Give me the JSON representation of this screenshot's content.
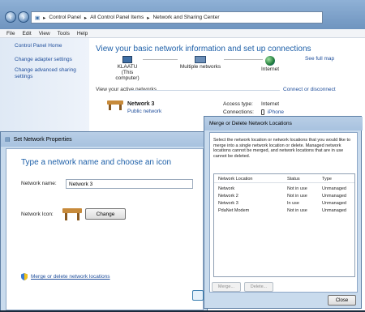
{
  "address_bar": {
    "crumbs": [
      "Control Panel",
      "All Control Panel Items",
      "Network and Sharing Center"
    ],
    "separator": "▸"
  },
  "menu": [
    "File",
    "Edit",
    "View",
    "Tools",
    "Help"
  ],
  "left_pane": {
    "links": [
      "Control Panel Home",
      "Change adapter settings",
      "Change advanced sharing settings"
    ]
  },
  "main": {
    "heading": "View your basic network information and set up connections",
    "see_full_map": "See full map",
    "map": {
      "computer": "KLAATU",
      "computer_sub": "(This computer)",
      "middle": "Multiple networks",
      "internet": "Internet"
    },
    "active_networks_label": "View your active networks",
    "connect_disconnect": "Connect or disconnect",
    "network": {
      "name": "Network 3",
      "type": "Public network",
      "access_label": "Access type:",
      "access_value": "Internet",
      "connections_label": "Connections:",
      "connections_value": "iPhone"
    }
  },
  "set_props_dialog": {
    "title": "Set Network Properties",
    "heading": "Type a network name and choose an icon",
    "name_label": "Network name:",
    "name_value": "Network 3",
    "icon_label": "Network Icon:",
    "change_button": "Change",
    "merge_link": "Merge or delete network locations"
  },
  "merge_dialog": {
    "title": "Merge or Delete Network Locations",
    "description": "Select the network location or network locations that you would like to merge into a single network location or delete. Managed network locations cannot be merged, and network locations that are in use cannot be deleted.",
    "columns": [
      "Network Location",
      "Status",
      "Type"
    ],
    "rows": [
      {
        "name": "Network",
        "status": "Not in use",
        "type": "Unmanaged"
      },
      {
        "name": "Network  2",
        "status": "Not in use",
        "type": "Unmanaged"
      },
      {
        "name": "Network  3",
        "status": "In use",
        "type": "Unmanaged"
      },
      {
        "name": "PdaNet Modem",
        "status": "Not in use",
        "type": "Unmanaged"
      }
    ],
    "merge_button": "Merge...",
    "delete_button": "Delete...",
    "close_button": "Close"
  },
  "colors": {
    "link": "#1f4e9b",
    "heading": "#1d5fa8",
    "dialog_frame": "#c9dbed"
  }
}
